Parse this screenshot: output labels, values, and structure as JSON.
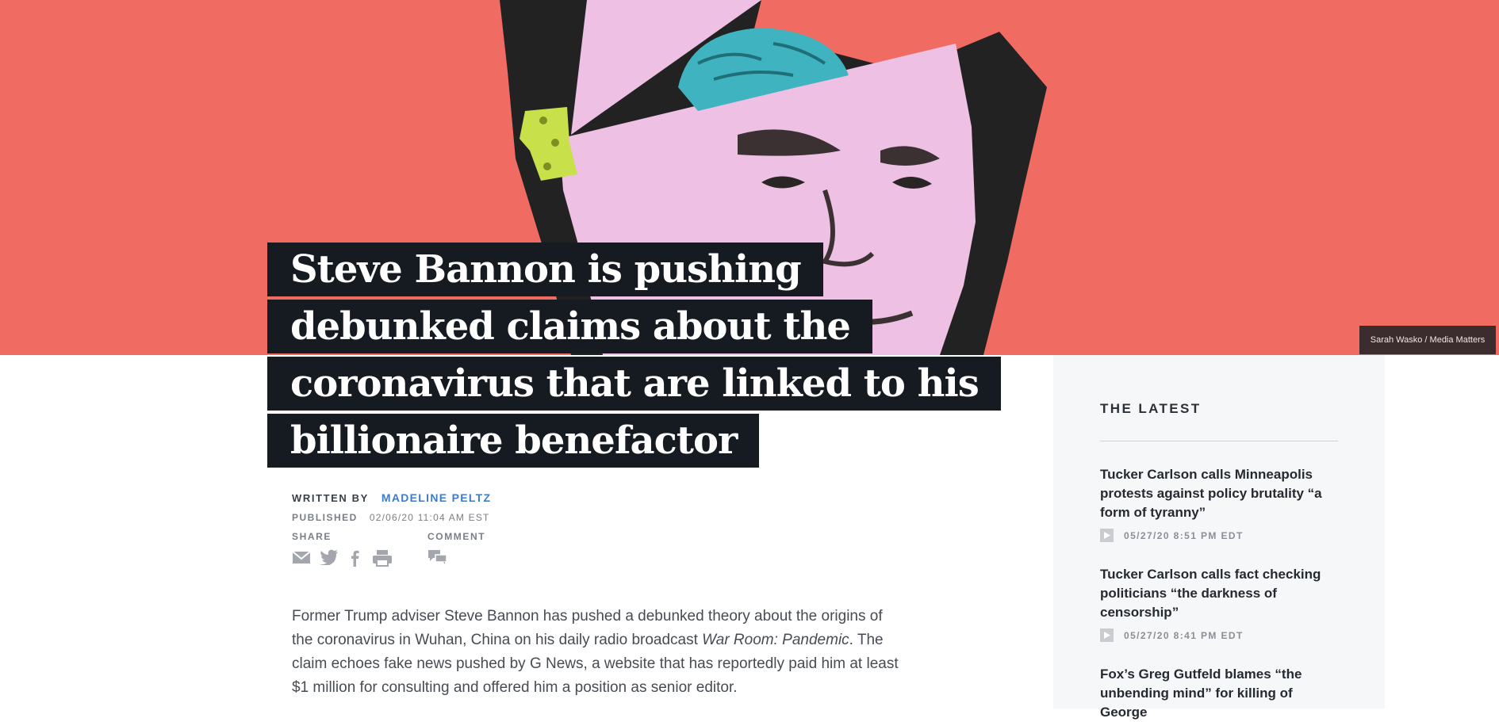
{
  "article": {
    "headline_lines": [
      "Steve Bannon is pushing",
      "debunked claims about the",
      "coronavirus that are linked to his",
      "billionaire benefactor"
    ],
    "image_credit": "Sarah Wasko / Media Matters",
    "written_by_label": "WRITTEN BY",
    "author": "MADELINE PELTZ",
    "published_label": "PUBLISHED",
    "published_date": "02/06/20 11:04 AM EST",
    "share_label": "SHARE",
    "comment_label": "COMMENT",
    "share_icons": [
      "email-icon",
      "twitter-icon",
      "facebook-icon",
      "print-icon"
    ],
    "comment_icon": "comment-icon",
    "body_part1": "Former Trump adviser Steve Bannon has pushed a debunked theory about the origins of the coronavirus in Wuhan, China on his daily radio broadcast ",
    "body_italic": "War Room: Pandemic",
    "body_part2": ". The claim echoes fake news pushed by G News, a website that has reportedly paid him at least $1 million for consulting and offered him a position as senior editor."
  },
  "sidebar": {
    "title": "THE LATEST",
    "items": [
      {
        "title": "Tucker Carlson calls Minneapolis protests against policy brutality “a form of tyranny”",
        "date": "05/27/20 8:51 PM EDT"
      },
      {
        "title": "Tucker Carlson calls fact checking politicians “the darkness of censorship”",
        "date": "05/27/20 8:41 PM EDT"
      },
      {
        "title": "Fox’s Greg Gutfeld blames “the unbending mind” for killing of George",
        "date": ""
      }
    ]
  },
  "colors": {
    "hero_background": "#f06b62",
    "headline_background": "#161b22",
    "author_link": "#3f7bc8",
    "sidebar_background": "#f6f7f9"
  }
}
